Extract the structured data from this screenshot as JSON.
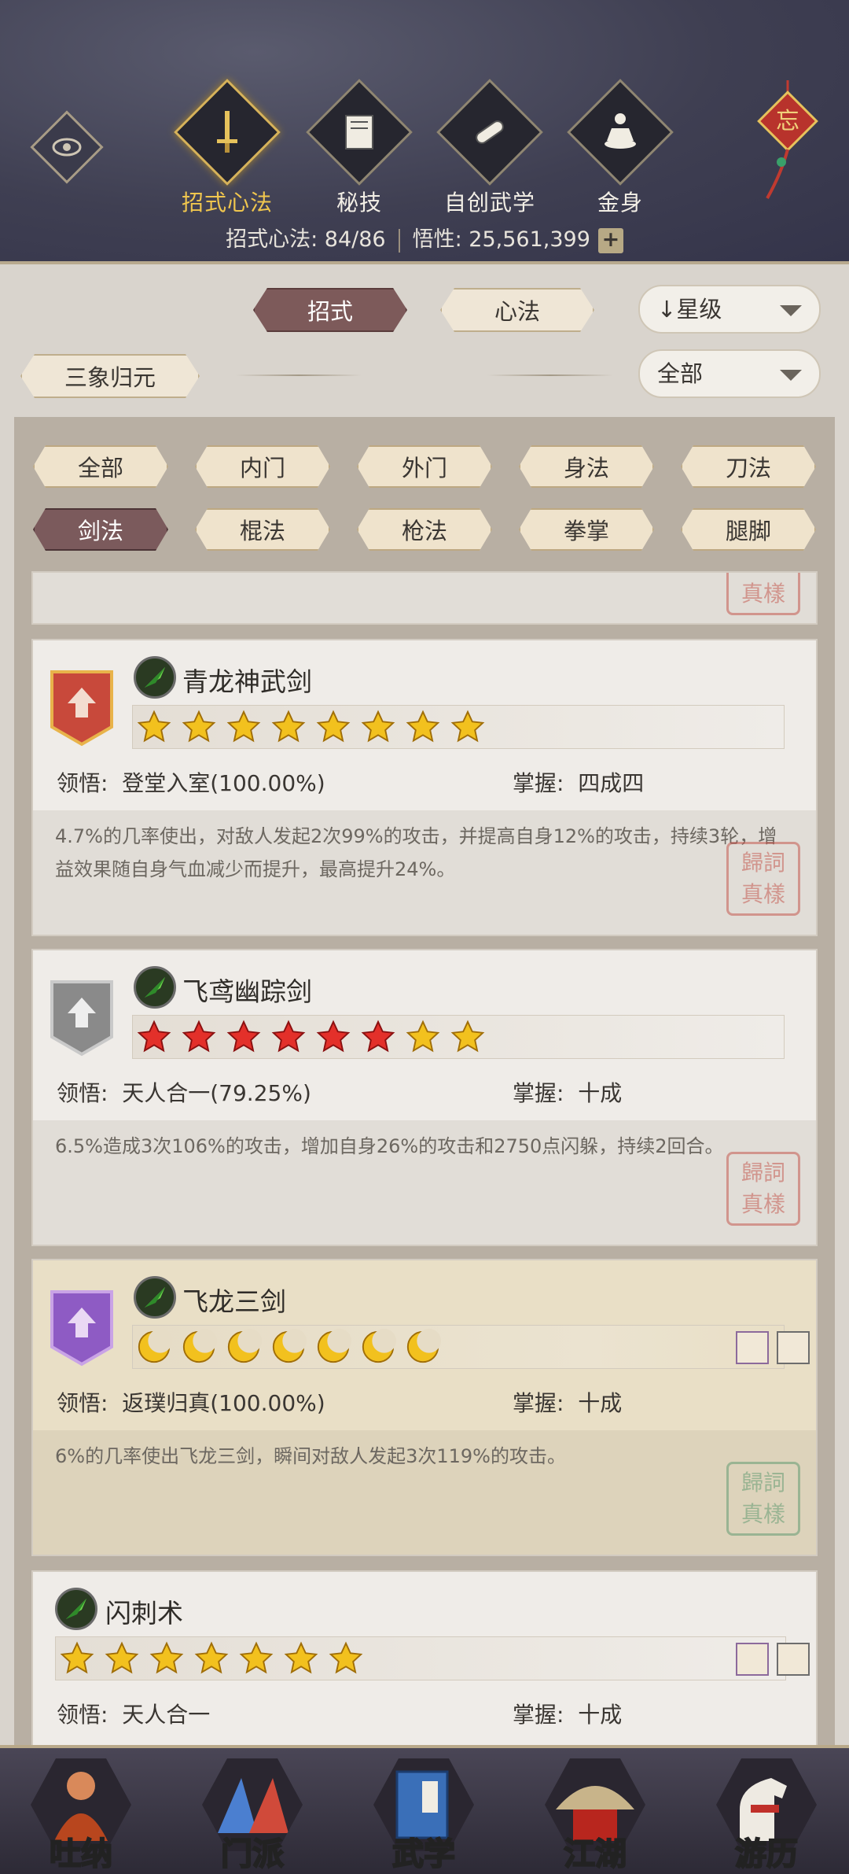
{
  "top_tabs": [
    {
      "label": "招式心法",
      "icon": "sword-icon",
      "active": true
    },
    {
      "label": "秘技",
      "icon": "book-icon",
      "active": false
    },
    {
      "label": "自创武学",
      "icon": "scroll-icon",
      "active": false
    },
    {
      "label": "金身",
      "icon": "meditation-icon",
      "active": false
    }
  ],
  "stats": {
    "moves_label": "招式心法: 84/86",
    "insight_label": "悟性: 25,561,399"
  },
  "filters": {
    "type_a": "招式",
    "type_b": "心法",
    "sort": "星级",
    "sort_arrow": "↓",
    "set_name": "三象归元",
    "scope": "全部"
  },
  "categories": [
    "全部",
    "内门",
    "外门",
    "身法",
    "刀法",
    "剑法",
    "棍法",
    "枪法",
    "拳掌",
    "腿脚"
  ],
  "active_category": "剑法",
  "seal_text": [
    "歸",
    "詞",
    "真",
    "樣"
  ],
  "skills": [
    {
      "name": "青龙神武剑",
      "rank_color": "#c8493b",
      "star_type": "gold",
      "stars": 8,
      "comprehension_label": "领悟:",
      "comprehension_value": "登堂入室(100.00%)",
      "mastery_label": "掌握:",
      "mastery_value": "四成四",
      "description": "4.7%的几率使出，对敌人发起2次99%的攻击，并提高自身12%的攻击，持续3轮，增益效果随自身气血减少而提升，最高提升24%。"
    },
    {
      "name": "飞鸢幽踪剑",
      "rank_color": "#8a8a8a",
      "star_type": "red-gold",
      "stars": 8,
      "red_stars": 6,
      "comprehension_label": "领悟:",
      "comprehension_value": "天人合一(79.25%)",
      "mastery_label": "掌握:",
      "mastery_value": "十成",
      "description": "6.5%造成3次106%的攻击，增加自身26%的攻击和2750点闪躲，持续2回合。"
    },
    {
      "name": "飞龙三剑",
      "rank_color": "#8e5bc4",
      "star_type": "moon",
      "stars": 7,
      "comprehension_label": "领悟:",
      "comprehension_value": "返璞归真(100.00%)",
      "mastery_label": "掌握:",
      "mastery_value": "十成",
      "description": "6%的几率使出飞龙三剑，瞬间对敌人发起3次119%的攻击。"
    },
    {
      "name": "闪刺术",
      "star_type": "gold",
      "stars": 7,
      "comprehension_label": "领悟:",
      "comprehension_value": "天人合一",
      "mastery_label": "掌握:",
      "mastery_value": "十成"
    }
  ],
  "bottom_nav": [
    {
      "label": "吐纳",
      "icon": "monk-icon",
      "active": false
    },
    {
      "label": "门派",
      "icon": "sect-icon",
      "active": false
    },
    {
      "label": "武学",
      "icon": "martial-book-icon",
      "active": true
    },
    {
      "label": "江湖",
      "icon": "bamboo-hat-icon",
      "active": false
    },
    {
      "label": "游历",
      "icon": "horse-icon",
      "active": false
    }
  ],
  "colors": {
    "accent_gold": "#f0c64e",
    "active_pill": "#7d5a5a",
    "header_bg": "#3f3f52"
  }
}
